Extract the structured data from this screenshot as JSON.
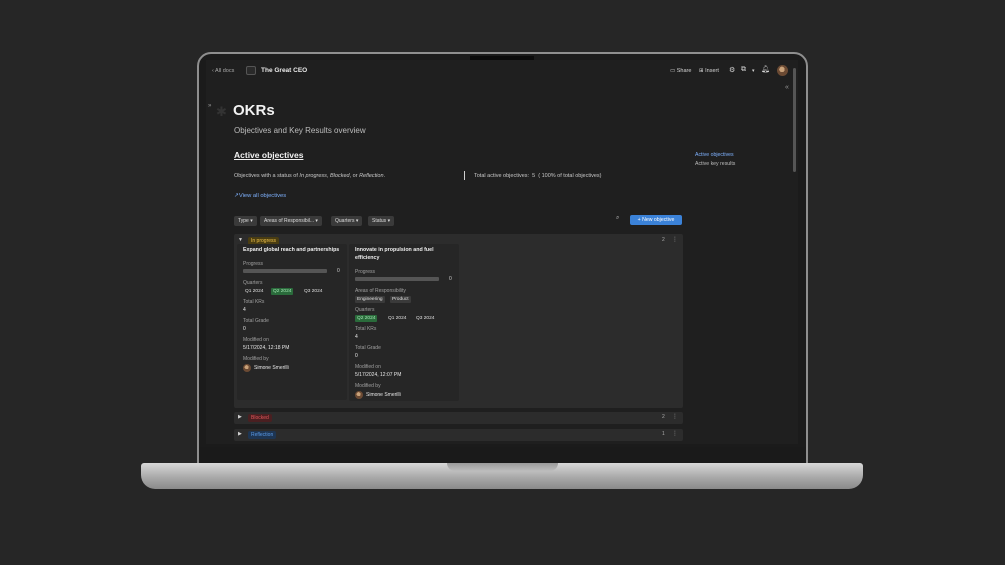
{
  "topbar": {
    "back_label": "‹ All docs",
    "doc_title": "The Great CEO",
    "share_label": "Share",
    "insert_label": "Insert"
  },
  "page": {
    "title": "OKRs",
    "subtitle": "Objectives and Key Results overview"
  },
  "section": {
    "title": "Active objectives",
    "desc_prefix": "Objectives with a status of ",
    "status_in_progress": "In progress",
    "desc_sep1": ", ",
    "status_blocked": "Blocked",
    "desc_sep2": ", or ",
    "status_reflection": "Reflection",
    "desc_suffix": ".",
    "total_label": "Total active objectives:",
    "total_count": "5",
    "total_pct": "( 100% of total objectives)",
    "view_all": "↗View all objectives"
  },
  "toc": {
    "items": [
      "Active objectives",
      "Active key results"
    ]
  },
  "filters": {
    "type": "Type",
    "areas": "Areas of Responsibil...",
    "quarters": "Quarters",
    "status": "Status",
    "new_objective": "+ New objective"
  },
  "groups": [
    {
      "name": "In progress",
      "count": "2",
      "color": "#f0c24a",
      "cards": [
        {
          "title": "Expand global reach and partnerships",
          "progress_label": "Progress",
          "progress_value": "0",
          "quarters_label": "Quarters",
          "quarters": [
            "Q1 2024",
            "Q2 2024",
            "Q3 2024"
          ],
          "total_krs_label": "Total KRs",
          "total_krs": "4",
          "total_grade_label": "Total Grade",
          "total_grade": "0",
          "modified_on_label": "Modified on",
          "modified_on": "5/17/2024, 12:18 PM",
          "modified_by_label": "Modified by",
          "modified_by": "Simone Smerilli"
        },
        {
          "title": "Innovate in propulsion and fuel efficiency",
          "progress_label": "Progress",
          "progress_value": "0",
          "areas_label": "Areas of Responsibility",
          "areas": [
            "Engineering",
            "Product"
          ],
          "quarters_label": "Quarters",
          "quarters": [
            "Q2 2024",
            "Q1 2024",
            "Q3 2024"
          ],
          "total_krs_label": "Total KRs",
          "total_krs": "4",
          "total_grade_label": "Total Grade",
          "total_grade": "0",
          "modified_on_label": "Modified on",
          "modified_on": "5/17/2024, 12:07 PM",
          "modified_by_label": "Modified by",
          "modified_by": "Simone Smerilli"
        }
      ]
    },
    {
      "name": "Blocked",
      "count": "2",
      "color": "#e2565a"
    },
    {
      "name": "Reflection",
      "count": "1",
      "color": "#5b9be8"
    }
  ],
  "colors": {
    "accent": "#3b82d8",
    "link": "#7fb2ff",
    "chip_green": "#2a6b3b"
  }
}
